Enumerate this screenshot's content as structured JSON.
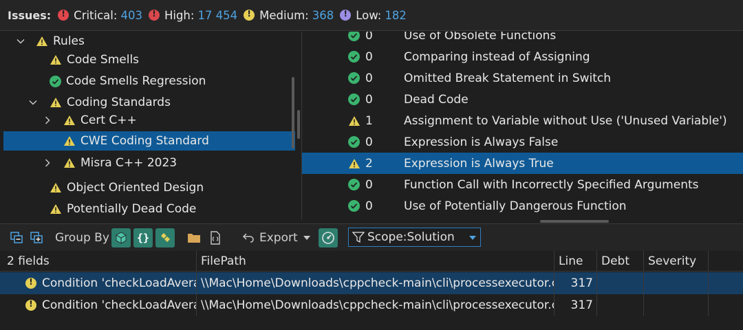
{
  "issues_bar": {
    "label": "Issues:",
    "critical": {
      "label": "Critical:",
      "count": "403"
    },
    "high": {
      "label": "High:",
      "count": "17 454"
    },
    "medium": {
      "label": "Medium:",
      "count": "368"
    },
    "low": {
      "label": "Low:",
      "count": "182"
    }
  },
  "tree": {
    "items": [
      {
        "label": "Rules",
        "status": "warning",
        "expanded": true
      },
      {
        "label": "Code Smells",
        "status": "warning"
      },
      {
        "label": "Code Smells Regression",
        "status": "ok"
      },
      {
        "label": "Coding Standards",
        "status": "warning",
        "expanded": true
      },
      {
        "label": "Cert C++",
        "status": "warning",
        "expanded": false
      },
      {
        "label": "CWE Coding Standard",
        "status": "warning",
        "selected": true
      },
      {
        "label": "Misra C++ 2023",
        "status": "warning",
        "expanded": false
      },
      {
        "label": "Object Oriented Design",
        "status": "warning"
      },
      {
        "label": "Potentially Dead Code",
        "status": "warning"
      }
    ]
  },
  "rules": [
    {
      "status": "ok",
      "count": "0",
      "name": "Use of Obsolete Functions"
    },
    {
      "status": "ok",
      "count": "0",
      "name": "Comparing instead of Assigning"
    },
    {
      "status": "ok",
      "count": "0",
      "name": "Omitted Break Statement in Switch"
    },
    {
      "status": "ok",
      "count": "0",
      "name": "Dead Code"
    },
    {
      "status": "warning",
      "count": "1",
      "name": "Assignment to Variable without Use ('Unused Variable')"
    },
    {
      "status": "ok",
      "count": "0",
      "name": "Expression is Always False"
    },
    {
      "status": "warning",
      "count": "2",
      "name": "Expression is Always True",
      "selected": true
    },
    {
      "status": "ok",
      "count": "0",
      "name": "Function Call with Incorrectly Specified Arguments"
    },
    {
      "status": "ok",
      "count": "0",
      "name": "Use of Potentially Dangerous Function"
    }
  ],
  "toolbar": {
    "group_by_label": "Group By",
    "export_label": "Export",
    "scope_label": "Scope:Solution"
  },
  "grid": {
    "columns": [
      "2 fields",
      "FilePath",
      "Line",
      "Debt",
      "Severity"
    ],
    "rows": [
      {
        "description": "Condition 'checkLoadAverage",
        "file_path": "\\\\Mac\\Home\\Downloads\\cppcheck-main\\cli\\processexecutor.cpp",
        "line": "317",
        "debt": "",
        "severity": ""
      },
      {
        "description": "Condition 'checkLoadAverage",
        "file_path": "\\\\Mac\\Home\\Downloads\\cppcheck-main\\cli\\processexecutor.cpp",
        "line": "317",
        "debt": "",
        "severity": ""
      }
    ]
  },
  "colors": {
    "accent": "#0f5a96",
    "count_blue": "#4fa3e0",
    "warning_yellow": "#e5cf55",
    "ok_green": "#3ab36e",
    "critical_red": "#e0474c",
    "low_purple": "#9b8ee3"
  }
}
